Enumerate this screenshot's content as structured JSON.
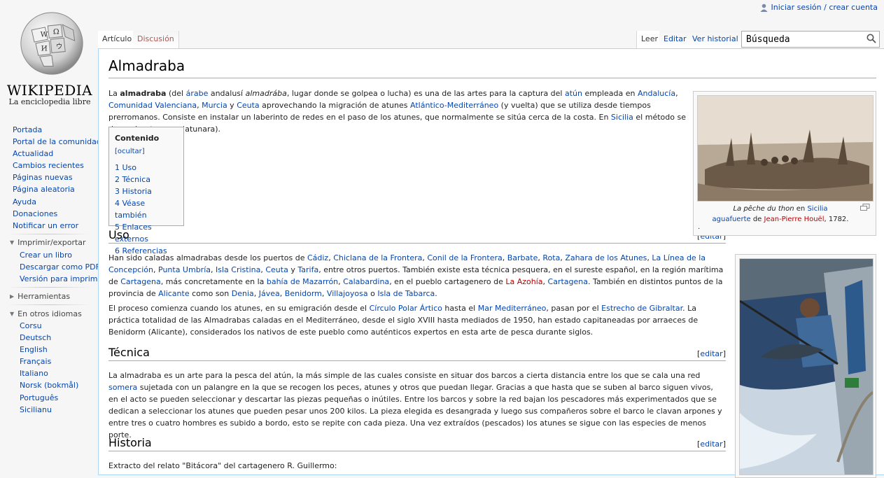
{
  "logo": {
    "wordmark": "WIKIPEDIA",
    "tagline": "La enciclopedia libre"
  },
  "personal": {
    "login_label": "Iniciar sesión / crear cuenta"
  },
  "tabs": {
    "left": [
      "Artículo",
      "Discusión"
    ],
    "right": [
      "Leer",
      "Editar",
      "Ver historial"
    ]
  },
  "search": {
    "value": "Búsqueda"
  },
  "sidebar": {
    "nav": [
      "Portada",
      "Portal de la comunidad",
      "Actualidad",
      "Cambios recientes",
      "Páginas nuevas",
      "Página aleatoria",
      "Ayuda",
      "Donaciones",
      "Notificar un error"
    ],
    "print_heading": "Imprimir/exportar",
    "print_items": [
      "Crear un libro",
      "Descargar como PDF",
      "Versión para imprimir"
    ],
    "tools_heading": "Herramientas",
    "lang_heading": "En otros idiomas",
    "languages": [
      "Corsu",
      "Deutsch",
      "English",
      "Français",
      "Italiano",
      "Norsk (bokmål)",
      "Português",
      "Sicilianu"
    ]
  },
  "article": {
    "title": "Almadraba",
    "toc": {
      "title": "Contenido",
      "toggle": "[ocultar]",
      "items": [
        "1 Uso",
        "2 Técnica",
        "3 Historia",
        "4 Véase también",
        "5 Enlaces externos",
        "6 Referencias"
      ]
    },
    "edit_label": "[editar]",
    "sections": {
      "uso": "Uso",
      "tecnica": "Técnica",
      "historia": "Historia"
    },
    "historia_text": "Extracto del relato \"Bitácora\" del cartagenero R. Guillermo:",
    "caption1": {
      "title": "La pêche du thon",
      "en": " en ",
      "place": "Sicilia",
      "kind": "aguafuerte",
      "de": " de ",
      "author": "Jean-Pierre Houël",
      "year": ", 1782.",
      "dot": "."
    }
  },
  "colors": {
    "link": "#0645ad",
    "redlink": "#ba0000",
    "border": "#a7d7f9"
  }
}
